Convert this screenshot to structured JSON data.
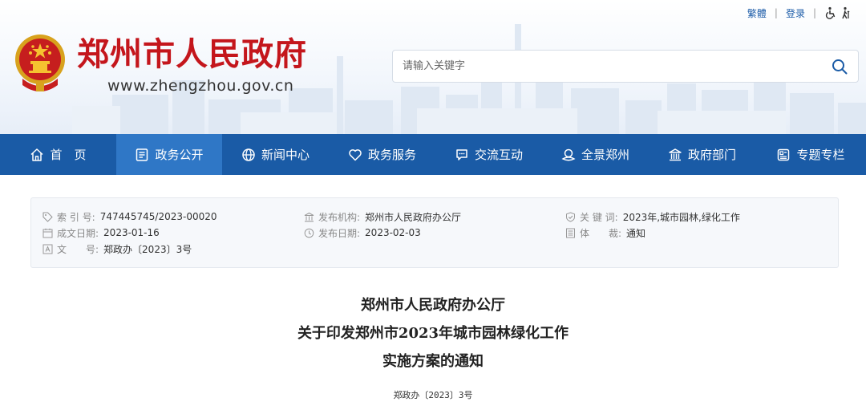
{
  "header": {
    "top_links": {
      "traditional": "繁體",
      "login": "登录",
      "separator": "|"
    },
    "site_title": "郑州市人民政府",
    "site_url": "www.zhengzhou.gov.cn",
    "search": {
      "placeholder": "请输入关键字"
    }
  },
  "nav": {
    "items": [
      {
        "label": "首　页",
        "icon": "home-icon"
      },
      {
        "label": "政务公开",
        "icon": "document-icon"
      },
      {
        "label": "新闻中心",
        "icon": "globe-icon"
      },
      {
        "label": "政务服务",
        "icon": "heart-icon"
      },
      {
        "label": "交流互动",
        "icon": "chat-icon"
      },
      {
        "label": "全景郑州",
        "icon": "panorama-icon"
      },
      {
        "label": "政府部门",
        "icon": "building-icon"
      },
      {
        "label": "专题专栏",
        "icon": "special-icon"
      }
    ],
    "active_index": 1
  },
  "meta": {
    "index_no": {
      "label": "索 引 号:",
      "value": "747445745/2023-00020"
    },
    "publisher": {
      "label": "发布机构:",
      "value": "郑州市人民政府办公厅"
    },
    "keywords": {
      "label": "关 键 词:",
      "value": "2023年,城市园林,绿化工作"
    },
    "created": {
      "label": "成文日期:",
      "value": "2023-01-16"
    },
    "published": {
      "label": "发布日期:",
      "value": "2023-02-03"
    },
    "genre": {
      "label": "体　　裁:",
      "value": "通知"
    },
    "doc_no": {
      "label": "文　　号:",
      "value": "郑政办〔2023〕3号"
    }
  },
  "document": {
    "title_line1": "郑州市人民政府办公厅",
    "title_line2": "关于印发郑州市2023年城市园林绿化工作",
    "title_line3": "实施方案的通知",
    "doc_number": "郑政办〔2023〕3号"
  },
  "colors": {
    "nav_bg": "#1a5ba6",
    "nav_active": "#2f77c6",
    "title_red": "#c4161c",
    "link_blue": "#1c5ca8"
  }
}
